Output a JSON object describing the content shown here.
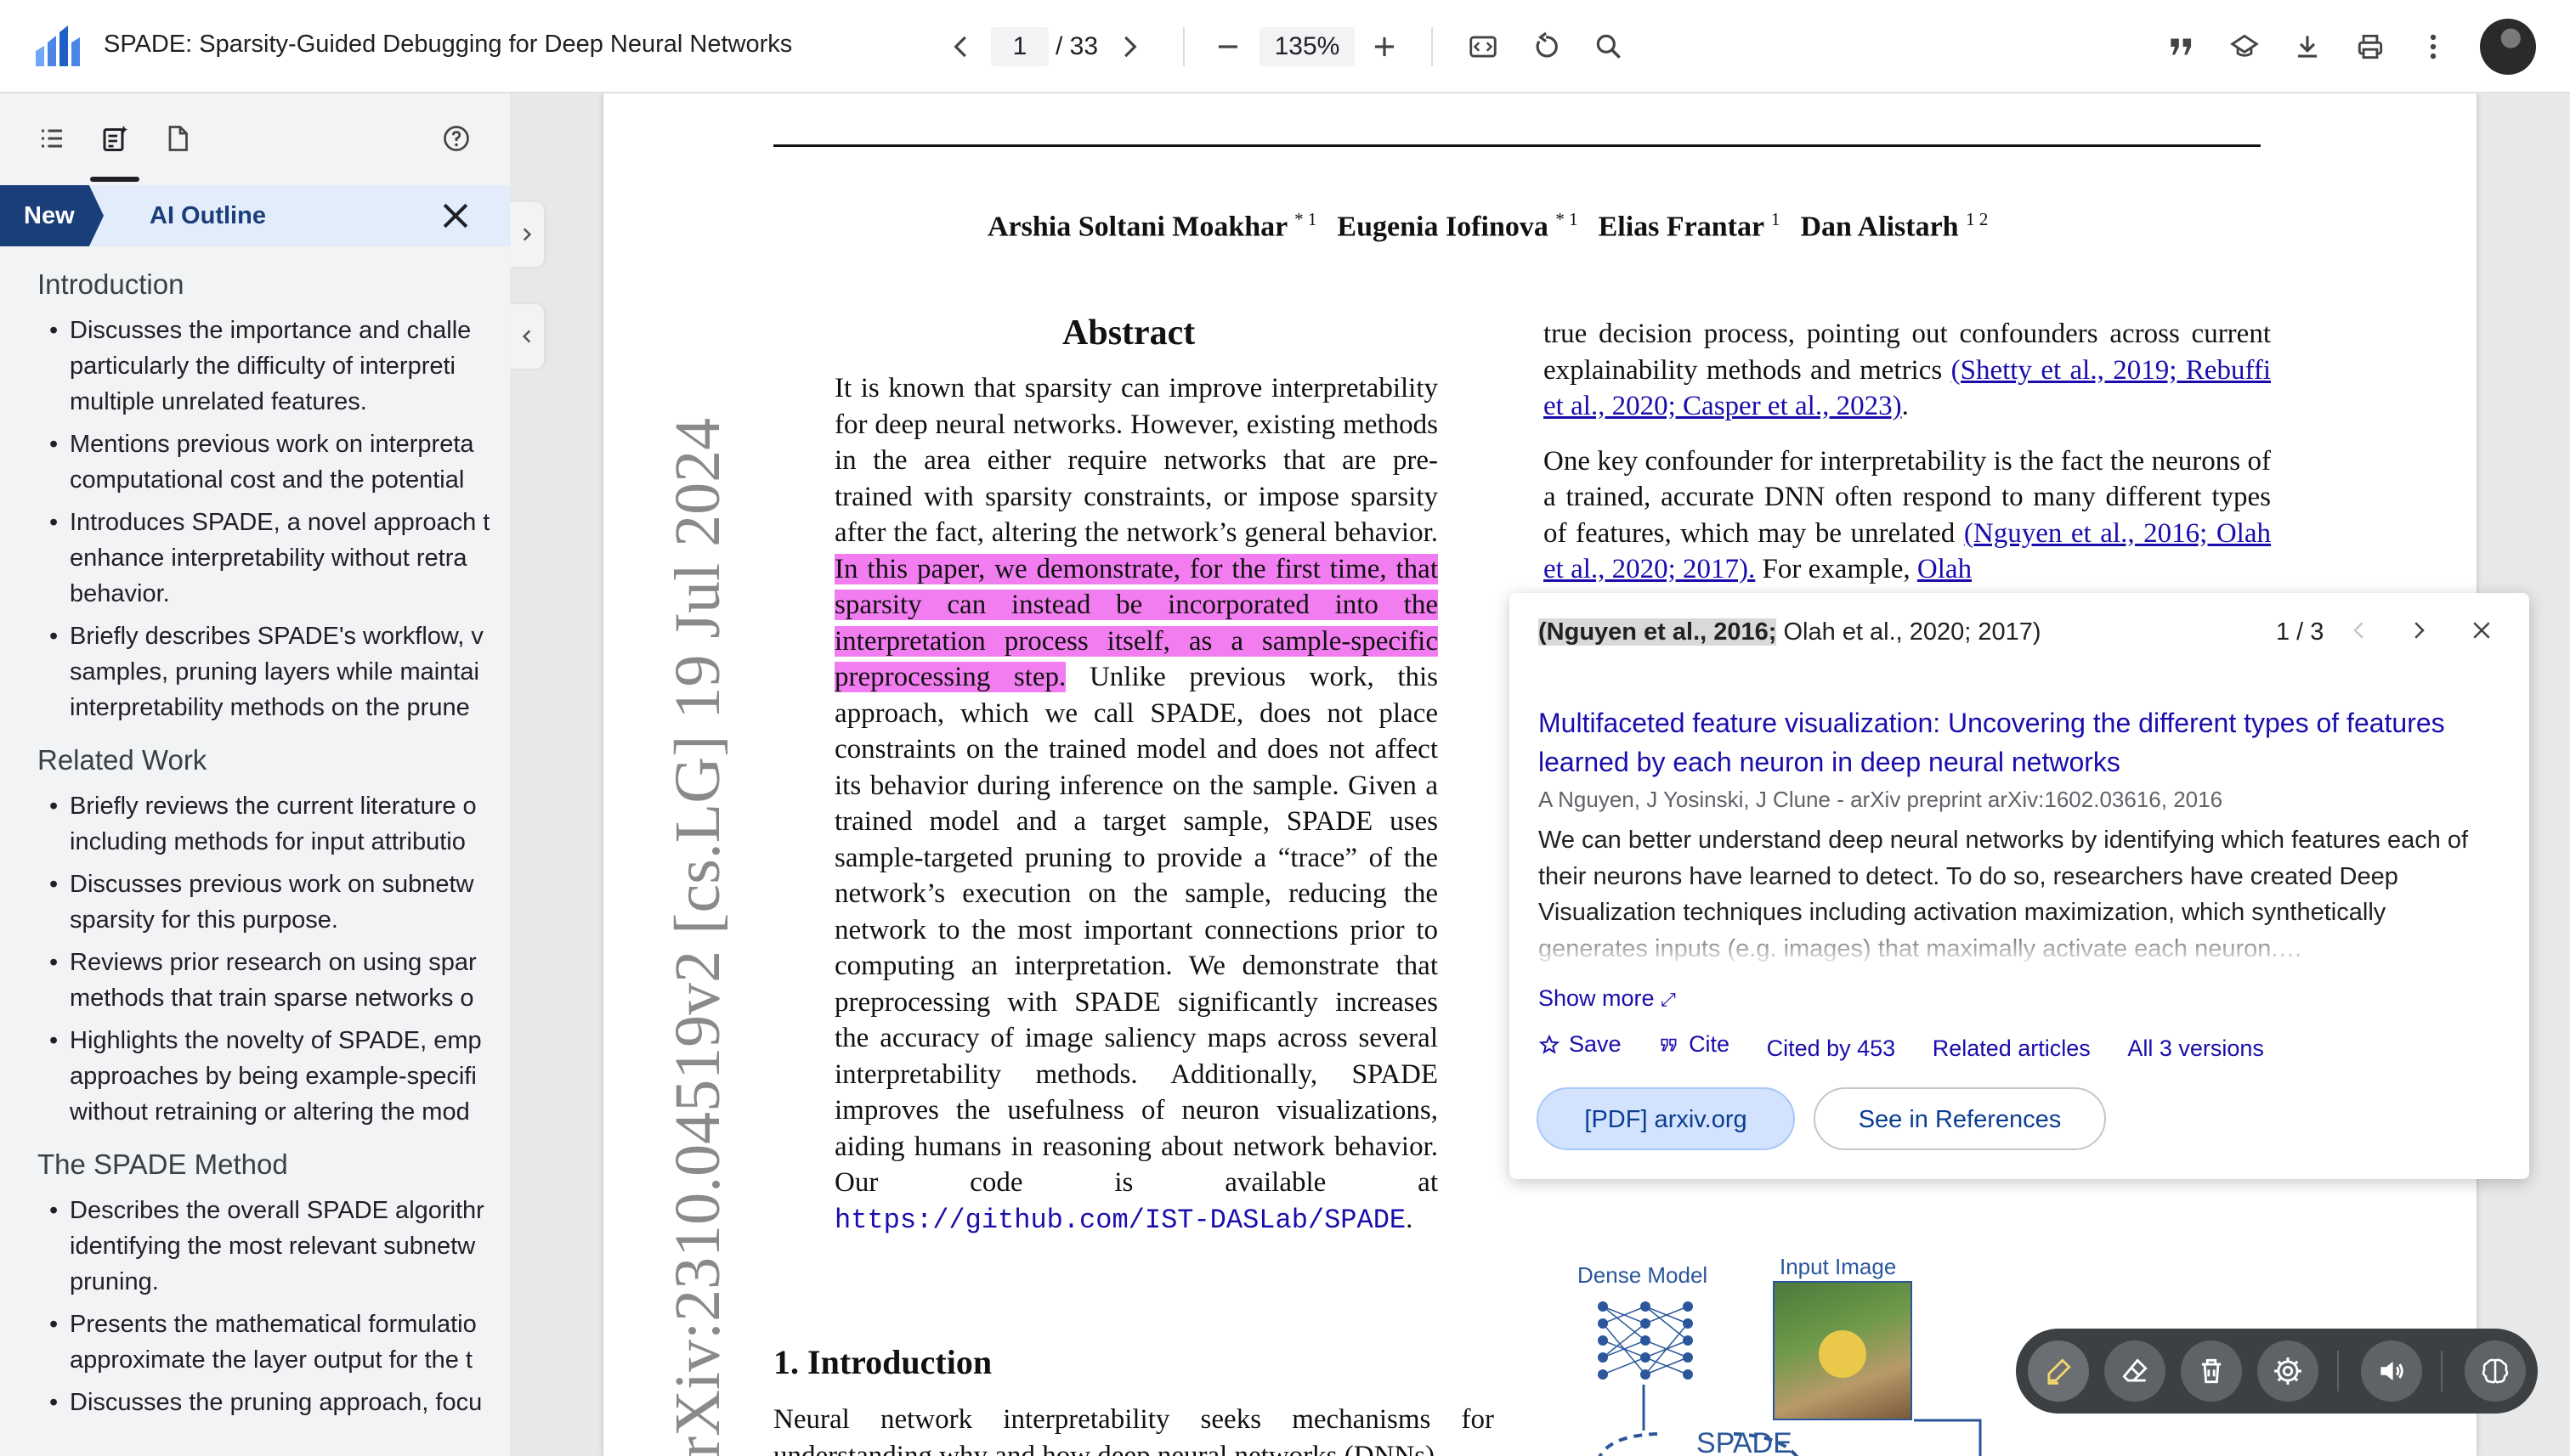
{
  "app": {
    "title": "SPADE: Sparsity-Guided Debugging for Deep Neural Networks",
    "logo": "scholar-pdf-reader-logo"
  },
  "toolbar": {
    "current_page": "1",
    "total_pages": "/ 33",
    "zoom": "135%",
    "icons": [
      "chevron-left-icon",
      "chevron-right-icon",
      "zoom-out-icon",
      "zoom-in-icon",
      "fit-width-icon",
      "rotate-icon",
      "search-icon",
      "cite-icon",
      "scholar-icon",
      "download-icon",
      "print-icon",
      "more-vert-icon"
    ]
  },
  "sidebar": {
    "tabs": [
      "toc-icon",
      "ai-outline-icon",
      "page-thumbnails-icon",
      "help-icon"
    ],
    "new_badge": "New",
    "header_title": "AI Outline",
    "sections": [
      {
        "heading": "Introduction",
        "items": [
          [
            "Discusses the importance and challe",
            "particularly the difficulty of interpreti",
            "multiple unrelated features."
          ],
          [
            "Mentions previous work on interpreta",
            "computational cost and the potential"
          ],
          [
            "Introduces SPADE, a novel approach t",
            "enhance interpretability without retra",
            "behavior."
          ],
          [
            "Briefly describes SPADE's workflow, v",
            "samples, pruning layers while maintai",
            "interpretability methods on the prune"
          ]
        ]
      },
      {
        "heading": "Related Work",
        "items": [
          [
            "Briefly reviews the current literature o",
            "including methods for input attributio"
          ],
          [
            "Discusses previous work on subnetw",
            "sparsity for this purpose."
          ],
          [
            "Reviews prior research on using spar",
            "methods that train sparse networks o"
          ],
          [
            "Highlights the novelty of SPADE, emp",
            "approaches by being example-specifi",
            "without retraining or altering the mod"
          ]
        ]
      },
      {
        "heading": "The SPADE Method",
        "items": [
          [
            "Describes the overall SPADE algorithr",
            "identifying the most relevant subnetw",
            "pruning."
          ],
          [
            "Presents the mathematical formulatio",
            "approximate the layer output for the t"
          ],
          [
            "Discusses the pruning approach, focu"
          ]
        ]
      }
    ]
  },
  "paper": {
    "authors": [
      {
        "name": "Arshia Soltani Moakhar",
        "sup": "* 1"
      },
      {
        "name": "Eugenia Iofinova",
        "sup": "* 1"
      },
      {
        "name": "Elias Frantar",
        "sup": "1"
      },
      {
        "name": "Dan Alistarh",
        "sup": "1 2"
      }
    ],
    "arxiv_stamp": "arXiv:2310.04519v2  [cs.LG]  19 Jul 2024",
    "abstract_heading": "Abstract",
    "abstract_before": "It is known that sparsity can improve interpretability for deep neural networks. However, existing methods in the area either require networks that are pre-trained with sparsity constraints, or impose sparsity after the fact, altering the network’s general behavior.",
    "abstract_highlight": "In this paper, we demonstrate, for the first time, that sparsity can instead be incorporated into the interpretation process itself, as a sample-specific preprocessing step.",
    "abstract_after": "Unlike previous work, this approach, which we call SPADE, does not place constraints on the trained model and does not affect its behavior during inference on the sample. Given a trained model and a target sample, SPADE uses sample-targeted pruning to provide a “trace” of the network’s execution on the sample, reducing the network to the most important connections prior to computing an interpretation. We demonstrate that preprocessing with SPADE significantly increases the accuracy of image saliency maps across several interpretability methods. Additionally, SPADE improves the usefulness of neuron visualizations, aiding humans in reasoning about network behavior. Our code is available at",
    "code_url": "https://github.com/IST-DASLab/SPADE",
    "right_p1_text": "true decision process, pointing out confounders across current explainability methods and metrics",
    "right_p1_cite": "(Shetty et al., 2019; Rebuffi et al., 2020; Casper et al., 2023)",
    "right_p2_text": "One key confounder for interpretability is the fact the neurons of a trained, accurate DNN often respond to many different types of features, which may be unrelated",
    "right_p2_cite": "(Nguyen et al., 2016; Olah et al., 2020; 2017).",
    "right_p2_tail": "For example,",
    "right_p2_cite2": "Olah",
    "intro_heading": "1. Introduction",
    "intro_text": "Neural network interpretability seeks mechanisms for understanding why and how deep neural networks (DNNs)",
    "figure": {
      "dense_model": "Dense Model",
      "input_image": "Input Image",
      "spade": "SPADE"
    }
  },
  "citation_popup": {
    "ref_highlight": "(Nguyen et al., 2016;",
    "ref_rest": " Olah et al., 2020; 2017)",
    "count": "1 / 3",
    "title": "Multifaceted feature visualization: Uncovering the different types of features learned by each neuron in deep neural networks",
    "meta": "A Nguyen, J Yosinski, J Clune - arXiv preprint arXiv:1602.03616, 2016",
    "abstract": "We can better understand deep neural networks by identifying which features each of their neurons have learned to detect. To do so, researchers have created Deep Visualization techniques including activation maximization, which synthetically generates inputs (e.g. images) that maximally activate each neuron.…",
    "show_more": "Show more",
    "actions": {
      "save": "Save",
      "cite": "Cite",
      "cited_by": "Cited by 453",
      "related": "Related articles",
      "versions": "All 3 versions"
    },
    "pdf_button": "[PDF] arxiv.org",
    "refs_button": "See in References"
  },
  "annotation_toolbar": {
    "tools": [
      "highlighter-icon",
      "eraser-icon",
      "trash-icon",
      "settings-icon",
      "read-aloud-icon",
      "ai-brain-icon"
    ]
  },
  "colors": {
    "highlight": "#f27df0",
    "link": "#1a0dab",
    "new_badge": "#1a3e7a",
    "ai_header_bg": "#e3ecfb",
    "arxiv_stamp": "#8a8a8a"
  }
}
